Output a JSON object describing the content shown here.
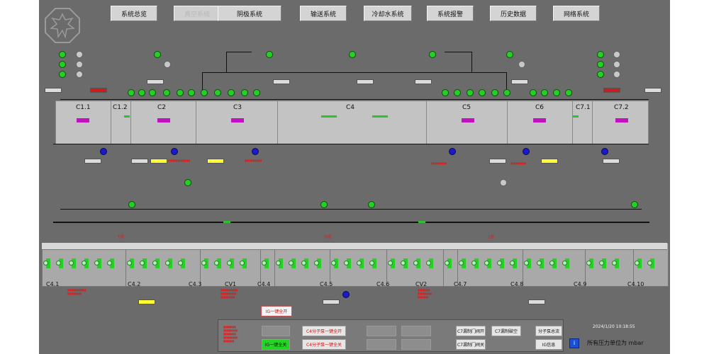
{
  "nav": [
    "系统总览",
    "真空系统",
    "阴极系统",
    "输送系统",
    "冷却水系统",
    "系统报警",
    "历史数据",
    "网络系统"
  ],
  "chambers": [
    "C1.1",
    "C1.2",
    "C2",
    "C3",
    "C4",
    "C5",
    "C6",
    "C7.1",
    "C7.2"
  ],
  "cells": [
    "C4.1",
    "C4.2",
    "C4.3",
    "CV1",
    "C4.4",
    "C4.5",
    "C4.6",
    "CV2",
    "C4.7",
    "C4.8",
    "C4.9",
    "C4.10"
  ],
  "section_labels": [
    "下层",
    "中层",
    "上层"
  ],
  "buttons": {
    "ig_all_open": "IG一键全开",
    "ig_all_off": "IG一键全关",
    "c4_open": "C4分子泵一键全开",
    "c4_close": "C4分子泵一键全关",
    "c7_open": "C7漏制门阀开",
    "c7_vent": "C7漏制破空",
    "c7_close": "C7漏制门阀关",
    "mp_flow": "分子泵总流",
    "ig_info": "IG信息",
    "info": "i"
  },
  "status": {
    "timestamp": "2024/1/20 10:18:55",
    "units": "所有压力单位为 mbar"
  },
  "colors": {
    "panel": "#6b6b6b",
    "chamber": "#c3c3c3",
    "pump_on": "#25d025",
    "mark": "#c012c0",
    "alarm": "#e01818"
  }
}
